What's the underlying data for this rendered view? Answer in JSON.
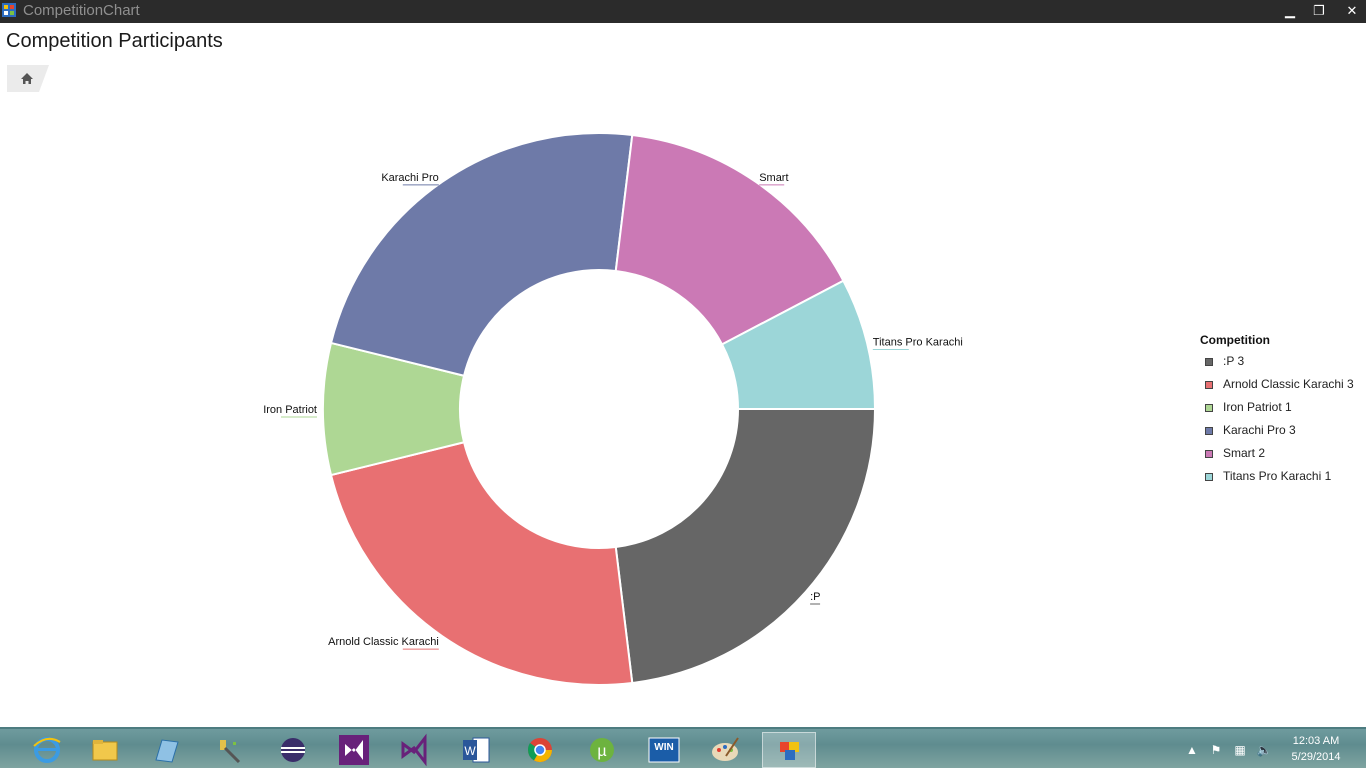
{
  "window": {
    "title": "CompetitionChart",
    "min_glyph": "▁",
    "max_glyph": "❐",
    "close_glyph": "✕"
  },
  "page": {
    "title": "Competition Participants",
    "home_icon": "home-icon"
  },
  "chart_data": {
    "type": "pie",
    "donut": true,
    "categories": [
      ":P",
      "Arnold Classic Karachi",
      "Iron Patriot",
      "Karachi Pro",
      "Smart",
      "Titans Pro Karachi"
    ],
    "values": [
      3,
      3,
      1,
      3,
      2,
      1
    ],
    "colors": [
      "#666666",
      "#e87072",
      "#aed794",
      "#6e7aa8",
      "#cb79b5",
      "#9cd6d8"
    ],
    "legend": {
      "title": "Competition",
      "placement": "right",
      "entries": [
        ":P 3",
        "Arnold Classic Karachi 3",
        "Iron Patriot 1",
        "Karachi Pro 3",
        "Smart 2",
        "Titans Pro Karachi 1"
      ]
    }
  },
  "taskbar": {
    "icons": [
      "internet-explorer-icon",
      "file-explorer-icon",
      "notepad-icon",
      "tools-icon",
      "eclipse-icon",
      "visual-studio-icon",
      "visual-studio-2-icon",
      "word-icon",
      "chrome-icon",
      "utorrent-icon",
      "winrar-icon",
      "paint-icon",
      "competition-chart-app-icon"
    ],
    "win_label": "WIN",
    "time": "12:03 AM",
    "date": "5/29/2014"
  }
}
